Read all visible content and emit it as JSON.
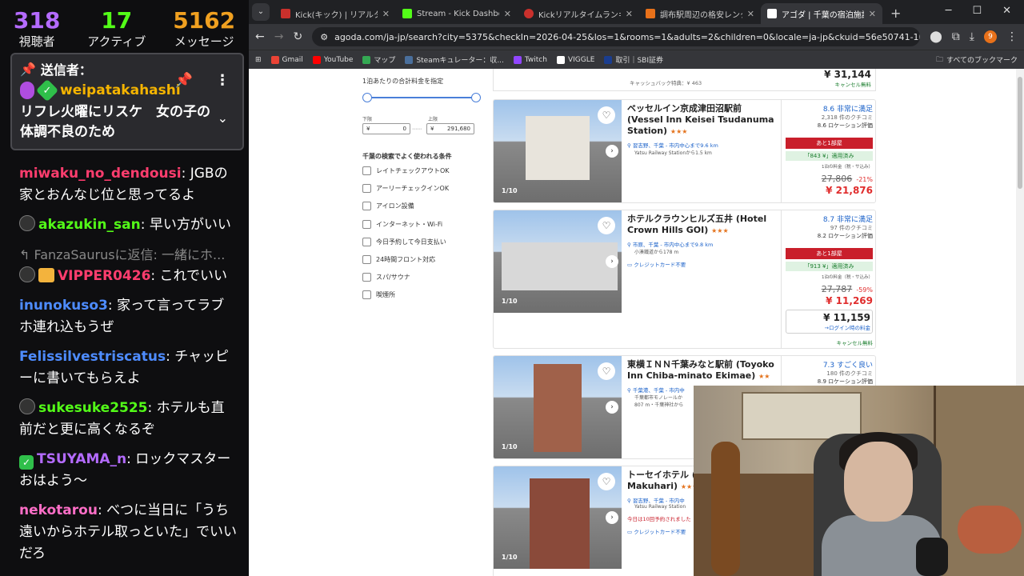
{
  "chat": {
    "stats": [
      {
        "value": "318",
        "label": "視聴者",
        "color": "#b46bff"
      },
      {
        "value": "17",
        "label": "アクティブ",
        "color": "#53fc18"
      },
      {
        "value": "5162",
        "label": "メッセージ",
        "color": "#f0a020"
      }
    ],
    "pinned": {
      "sender_label": "送信者：",
      "username": "weipatakahashi",
      "text": "リフレ火曜にリスケ　女の子の体調不良のため"
    },
    "messages": [
      {
        "user": "miwaku_no_dendousi",
        "color": "#ff3d6e",
        "text": ": JGBの家とおんなじ位と思ってるよ",
        "badge": ""
      },
      {
        "user": "akazukin_san",
        "color": "#53fc18",
        "text": ": 早い方がいい",
        "badge": "ninja"
      },
      {
        "reply": "FanzaSaurusに返信: 一緒にホ..."
      },
      {
        "user": "VIPPER0426",
        "color": "#ff3d6e",
        "text": ": これでいい",
        "badge": "ninja-gift"
      },
      {
        "user": "inunokuso3",
        "color": "#4e8cff",
        "text": ": 家って言ってラブホ連れ込もうぜ",
        "badge": ""
      },
      {
        "user": "Felissilvestriscatus",
        "color": "#4e8cff",
        "text": ": チャッピーに書いてもらえよ",
        "badge": ""
      },
      {
        "user": "sukesuke2525",
        "color": "#53fc18",
        "text": ": ホテルも直前だと更に高くなるぞ",
        "badge": "ninja"
      },
      {
        "user": "TSUYAMA_n",
        "color": "#b46bff",
        "text": ": ロックマスターおはよう～",
        "badge": "check"
      },
      {
        "user": "nekotarou",
        "color": "#ff6ec7",
        "text": ": べつに当日に「うち遠いからホテル取っといた」でいいだろ",
        "badge": ""
      }
    ]
  },
  "browser": {
    "tabs": [
      {
        "title": "Kick(キック) | リアルタイムラン",
        "fav": "#c9302c",
        "active": false
      },
      {
        "title": "Stream - Kick Dashboard",
        "fav": "#53fc18",
        "active": false
      },
      {
        "title": "Kickリアルタイムランキング |",
        "fav": "#c9302c",
        "active": false
      },
      {
        "title": "調布駅周辺の格安レンタカー",
        "fav": "#e8711a",
        "active": false
      },
      {
        "title": "アゴダ | 千葉の宿泊施設 |",
        "fav": "#ffffff",
        "active": true
      }
    ],
    "url": "agoda.com/ja-jp/search?city=5375&checkIn=2026-04-25&los=1&rooms=1&adults=2&children=0&locale=ja-jp&ckuid=56e50741-1ba0-4d...",
    "profile": "9",
    "bookmarks": [
      {
        "label": "Gmail",
        "color": "#ea4335"
      },
      {
        "label": "YouTube",
        "color": "#ff0000"
      },
      {
        "label": "マップ",
        "color": "#34a853"
      },
      {
        "label": "Steamキュレーター：収...",
        "color": "#1b2838"
      },
      {
        "label": "Twitch",
        "color": "#9146ff"
      },
      {
        "label": "VIGGLE",
        "color": "#ffffff"
      },
      {
        "label": "取引｜SBI証券",
        "color": "#1a3d8f"
      }
    ],
    "all_bookmarks": "すべてのブックマーク"
  },
  "filters": {
    "title": "1泊あたりの合計料金を指定",
    "min_label": "下限",
    "max_label": "上限",
    "min_currency": "¥",
    "min_value": "0",
    "max_currency": "¥",
    "max_value": "291,680",
    "common_title": "千葉の検索でよく使われる条件",
    "items": [
      "レイトチェックアウトOK",
      "アーリーチェックインOK",
      "アイロン設備",
      "インターネット・Wi-Fi",
      "今日予約して今日支払い",
      "24時間フロント対応",
      "スパ/サウナ",
      "喫煙所"
    ]
  },
  "top_strip": {
    "cashback": "キャッシュバック特典：¥ 463",
    "price": "¥ 31,144",
    "cancel": "キャンセル無料"
  },
  "hotels": [
    {
      "name": "ベッセルイン京成津田沼駅前 (Vessel Inn Keisei Tsudanuma Station)",
      "stars": "★★★",
      "loc": "習志野、千葉 - 市内中心まで9.6 km",
      "sub": "Yatsu Railway Stationから1.5 km",
      "note": "",
      "photo_count": "1/10",
      "score": "8.6 非常に満足",
      "reviews": "2,318 件のクチコミ",
      "loc_score": "8.6 ロケーション評価",
      "rooms_left": "あと1部屋",
      "coupon": "「843 ¥」適用済み",
      "per_night": "1泊の料金（税・サ込み）",
      "original": "27,806",
      "discount": "-21%",
      "price": "¥ 21,876",
      "login_price": "",
      "login_text": "",
      "free_cancel": ""
    },
    {
      "name": "ホテルクラウンヒルズ五井 (Hotel Crown Hills GOI)",
      "stars": "★★★",
      "loc": "市原、千葉 - 市内中心まで9.8 km",
      "sub": "小湊鐵道から178 m",
      "note": "クレジットカード不要",
      "photo_count": "1/10",
      "score": "8.7 非常に満足",
      "reviews": "97 件のクチコミ",
      "loc_score": "8.2 ロケーション評価",
      "rooms_left": "あと1部屋",
      "coupon": "「913 ¥」適用済み",
      "per_night": "1泊の料金（税・サ込み）",
      "original": "27,787",
      "discount": "-59%",
      "price": "¥ 11,269",
      "login_price": "¥ 11,159",
      "login_text": "→ログイン時の料金",
      "free_cancel": "キャンセル無料"
    },
    {
      "name": "東横ＩＮＮ千葉みなと駅前 (Toyoko Inn Chiba-minato Ekimae)",
      "stars": "★★",
      "loc": "千葉港、千葉 - 市内中",
      "sub": "千葉都市モノレールか",
      "note": "807 m・千葉神社から",
      "photo_count": "1/10",
      "score": "7.3 すごく良い",
      "reviews": "180 件のクチコミ",
      "loc_score": "8.9 ロケーション評価",
      "rooms_left": "",
      "coupon": "",
      "per_night": "",
      "original": "",
      "discount": "",
      "price": "",
      "login_price": "",
      "login_text": "",
      "free_cancel": ""
    },
    {
      "name": "トーセイホテル (Tosei Hotel Se Makuhari)",
      "stars": "★★★",
      "loc": "習志野、千葉 - 市内中",
      "sub": "Yatsu Railway Station",
      "note": "今日は10回予約されました",
      "note2": "クレジットカード不要",
      "photo_count": "1/10",
      "score": "",
      "reviews": "",
      "loc_score": "",
      "rooms_left": "",
      "coupon": "",
      "per_night": "",
      "original": "",
      "discount": "",
      "price": "",
      "login_price": "",
      "login_text": "",
      "free_cancel": ""
    }
  ]
}
